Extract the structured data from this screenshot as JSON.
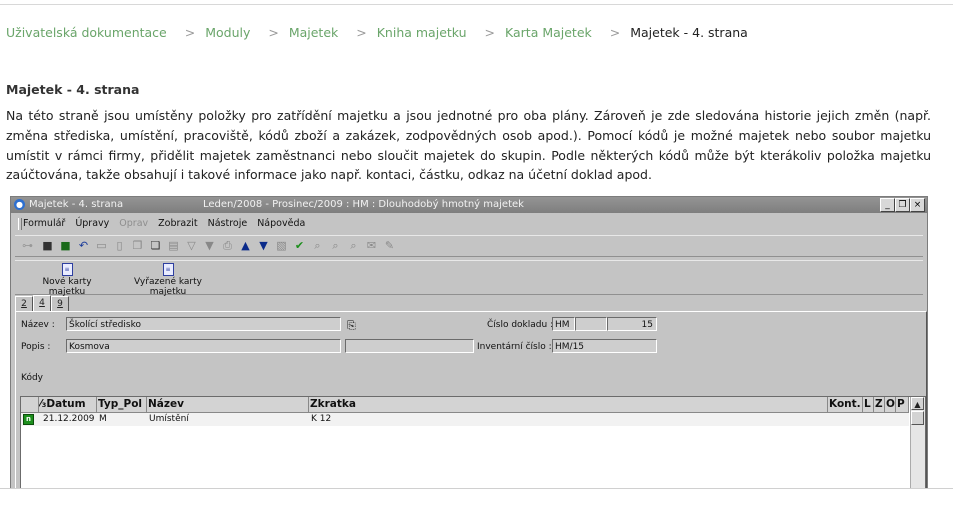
{
  "breadcrumb": {
    "items": [
      "Uživatelská dokumentace",
      "Moduly",
      "Majetek",
      "Kniha majetku",
      "Karta Majetek"
    ],
    "separator": ">",
    "current": "Majetek - 4. strana"
  },
  "heading": "Majetek - 4. strana",
  "paragraph": "Na této straně jsou umístěny položky pro zatřídění majetku a jsou jednotné pro oba plány. Zároveň je zde sledována historie jejich změn (např. změna střediska, umístění, pracoviště, kódů zboží a zakázek, zodpovědných osob apod.). Pomocí kódů je možné majetek nebo soubor majetku umístit v rámci firmy, přidělit majetek zaměstnanci nebo sloučit majetek do skupin. Podle některých kódů může být kterákoliv položka majetku zaúčtována, takže obsahují i takové informace jako např. kontaci, částku, odkaz na účetní doklad apod.",
  "window": {
    "title": "Majetek - 4. strana",
    "subtitle": "Leden/2008 - Prosinec/2009 : HM : Dlouhodobý hmotný majetek",
    "controls": {
      "minimize": "_",
      "restore": "❐",
      "close": "×"
    },
    "menu": [
      "Formulář",
      "Úpravy",
      "Oprav",
      "Zobrazit",
      "Nástroje",
      "Nápověda"
    ],
    "big_buttons": [
      "Nové karty majetku",
      "Vyřazené karty majetku"
    ],
    "tabs": [
      "2",
      "4",
      "9"
    ],
    "active_tab": "4",
    "form": {
      "nazev_label": "Název :",
      "nazev_value": "Školící středisko",
      "popis_label": "Popis :",
      "popis_value": "Kosmova",
      "cislo_dokladu_label": "Číslo dokladu :",
      "cislo_dokladu_prefix": "HM",
      "cislo_dokladu_mid": "",
      "cislo_dokladu_number": "15",
      "inventarni_cislo_label": "Inventární číslo :",
      "inventarni_cislo_value": "HM/15",
      "kody_label": "Kódy"
    },
    "grid": {
      "columns": [
        "⁄₃Datum",
        "Typ_Pol",
        "Název",
        "Zkratka",
        "Kont.",
        "L",
        "Z",
        "O",
        "P"
      ],
      "rows": [
        {
          "indicator": "n",
          "datum": "21.12.2009",
          "typ": "M",
          "nazev": "Umístění",
          "zkratka": "K 12"
        }
      ]
    }
  },
  "colors": {
    "link": "#6aa56a",
    "window_bg": "#c4c4c4",
    "titlebar": "#888888",
    "row_indicator": "#1d8f1d"
  }
}
